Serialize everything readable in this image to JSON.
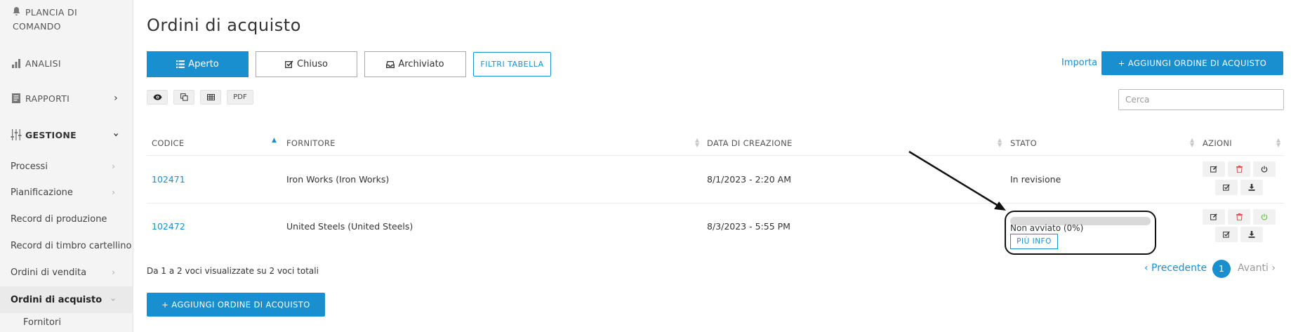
{
  "sidebar": {
    "items": [
      {
        "label": "PLANCIA DI COMANDO",
        "line1": "PLANCIA DI",
        "line2": "COMANDO"
      },
      {
        "label": "ANALISI"
      },
      {
        "label": "RAPPORTI"
      },
      {
        "label": "GESTIONE"
      },
      {
        "label": "Processi"
      },
      {
        "label": "Pianificazione"
      },
      {
        "label": "Record di produzione"
      },
      {
        "label": "Record di timbro cartellino"
      },
      {
        "label": "Ordini di vendita"
      },
      {
        "label": "Ordini di acquisto"
      },
      {
        "label": "Fornitori"
      }
    ]
  },
  "page": {
    "title": "Ordini di acquisto"
  },
  "tabs": [
    {
      "label": "Aperto",
      "icon": "list-icon"
    },
    {
      "label": "Chiuso",
      "icon": "check-square-icon"
    },
    {
      "label": "Archiviato",
      "icon": "inbox-icon"
    }
  ],
  "toolbar": {
    "filters_label": "FILTRI TABELLA",
    "import_label": "Importa",
    "add_label": "+ AGGIUNGI ORDINE DI ACQUISTO",
    "pdf_label": "PDF",
    "search_placeholder": "Cerca"
  },
  "table": {
    "headers": [
      "CODICE",
      "FORNITORE",
      "DATA DI CREAZIONE",
      "STATO",
      "AZIONI"
    ],
    "rows": [
      {
        "code": "102471",
        "supplier": "Iron Works (Iron Works)",
        "date": "8/1/2023 - 2:20 AM",
        "status": "In revisione"
      },
      {
        "code": "102472",
        "supplier": "United Steels (United Steels)",
        "date": "8/3/2023 - 5:55 PM",
        "status": "Non avviato (0%)",
        "progress": 0,
        "more_label": "PIÙ INFO"
      }
    ]
  },
  "footer": {
    "info": "Da 1 a 2 voci visualizzate su 2 voci totali",
    "prev_label": "‹ Precedente",
    "page": "1",
    "next_label": "Avanti ›",
    "add_label": "+ AGGIUNGI ORDINE DI ACQUISTO"
  },
  "colors": {
    "accent": "#1a8fd0",
    "delete": "#e05050",
    "power_on": "#6cbf4a"
  }
}
